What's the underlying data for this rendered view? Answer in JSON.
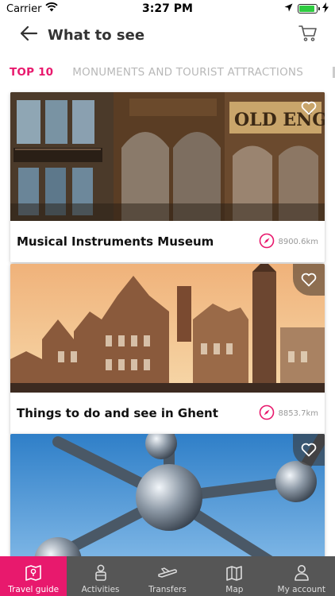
{
  "status_bar": {
    "carrier": "Carrier",
    "time": "3:27 PM",
    "battery_level": 0.9
  },
  "header": {
    "title": "What to see",
    "back_icon": "arrow-left-icon",
    "cart_icon": "shopping-cart-icon"
  },
  "tabs": [
    {
      "label": "TOP 10",
      "active": true
    },
    {
      "label": "MONUMENTS AND TOURIST ATTRACTIONS",
      "active": false
    }
  ],
  "cards": [
    {
      "title": "Musical Instruments Museum",
      "distance": "8900.6km",
      "favorite_icon": "heart-outline-icon"
    },
    {
      "title": "Things to do and see in Ghent",
      "distance": "8853.7km",
      "favorite_icon": "heart-outline-icon"
    },
    {
      "title": "",
      "distance": "",
      "favorite_icon": "heart-outline-icon"
    }
  ],
  "bottom_nav": [
    {
      "label": "Travel guide",
      "icon": "map-book-icon",
      "active": true
    },
    {
      "label": "Activities",
      "icon": "person-icon",
      "active": false
    },
    {
      "label": "Transfers",
      "icon": "airplane-icon",
      "active": false
    },
    {
      "label": "Map",
      "icon": "map-icon",
      "active": false
    },
    {
      "label": "My account",
      "icon": "user-icon",
      "active": false
    }
  ],
  "colors": {
    "accent": "#e8196d",
    "bottom_nav_bg": "#565656",
    "inactive_tab": "#b8b8b8"
  }
}
